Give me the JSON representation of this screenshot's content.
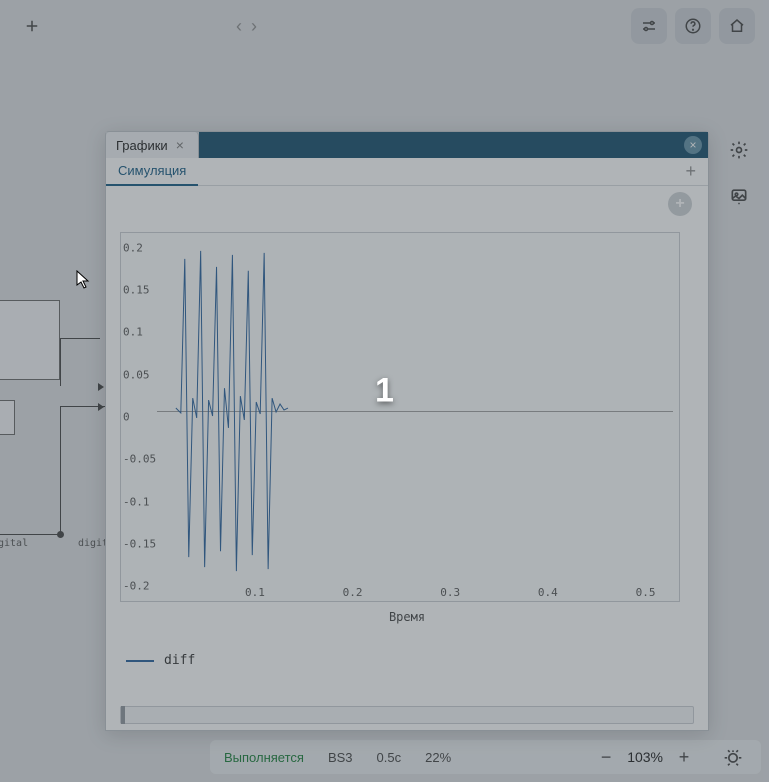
{
  "toolbar": {
    "loading": "‹ ›"
  },
  "diagram": {
    "port1": "gital",
    "port2": "digital"
  },
  "panel": {
    "tab_label": "Графики",
    "subtab_label": "Симуляция"
  },
  "chart_data": {
    "type": "line",
    "title": "",
    "xlabel": "Время",
    "ylabel": "",
    "xlim": [
      0,
      0.55
    ],
    "ylim": [
      -0.2,
      0.2
    ],
    "xticks": [
      0.1,
      0.2,
      0.3,
      0.4,
      0.5
    ],
    "yticks": [
      -0.2,
      -0.15,
      -0.1,
      -0.05,
      0,
      0.05,
      0.1,
      0.15,
      0.2
    ],
    "series": [
      {
        "name": "diff",
        "color": "#3b6fa6",
        "x": [
          0.02,
          0.025,
          0.03,
          0.035,
          0.04,
          0.045,
          0.05,
          0.055,
          0.06,
          0.065,
          0.07,
          0.075,
          0.08,
          0.085,
          0.09,
          0.095,
          0.1,
          0.105,
          0.11,
          0.115,
          0.12,
          0.125,
          0.13,
          0.135,
          0.14,
          0.145,
          0.15,
          0.155
        ],
        "y": [
          0.02,
          -0.03,
          0.18,
          -0.17,
          0.05,
          -0.06,
          0.19,
          -0.18,
          0.04,
          -0.05,
          0.17,
          -0.16,
          0.08,
          -0.09,
          0.18,
          -0.19,
          0.06,
          -0.07,
          0.16,
          -0.17,
          0.04,
          -0.05,
          0.19,
          -0.18,
          0.06,
          -0.05,
          0.03,
          -0.02
        ]
      }
    ]
  },
  "legend": {
    "label": "diff"
  },
  "status": {
    "state": "Выполняется",
    "solver": "BS3",
    "time": "0.5с",
    "progress": "22%",
    "zoom": "103%"
  },
  "overlay_number": "1"
}
